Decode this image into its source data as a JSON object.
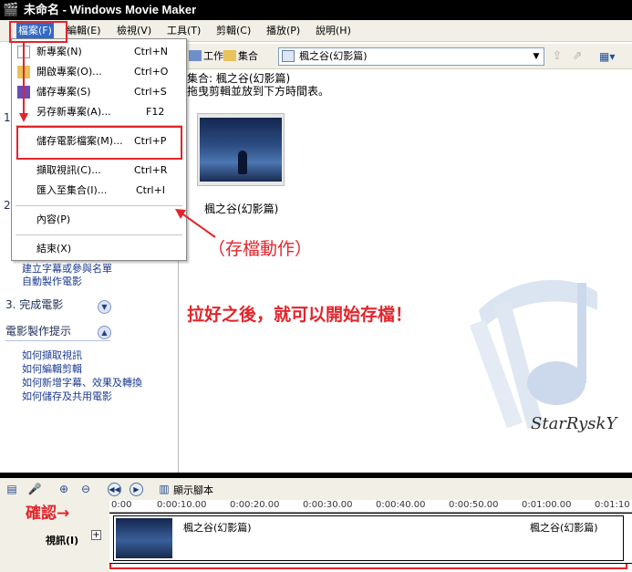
{
  "window": {
    "title": "未命名 - Windows Movie Maker"
  },
  "menu": {
    "items": [
      "檔案(F)",
      "編輯(E)",
      "檢視(V)",
      "工具(T)",
      "剪輯(C)",
      "播放(P)",
      "說明(H)"
    ]
  },
  "file_menu": {
    "items": [
      {
        "label": "新專案(N)",
        "shortcut": "Ctrl+N"
      },
      {
        "label": "開啟專案(O)...",
        "shortcut": "Ctrl+O"
      },
      {
        "label": "儲存專案(S)",
        "shortcut": "Ctrl+S"
      },
      {
        "label": "另存新專案(A)...",
        "shortcut": "F12"
      },
      {
        "label": "儲存電影檔案(M)...",
        "shortcut": "Ctrl+P"
      },
      {
        "label": "擷取視訊(C)...",
        "shortcut": "Ctrl+R"
      },
      {
        "label": "匯入至集合(I)...",
        "shortcut": "Ctrl+I"
      },
      {
        "label": "內容(P)",
        "shortcut": ""
      },
      {
        "label": "結束(X)",
        "shortcut": ""
      }
    ]
  },
  "toolbar": {
    "tasks_label": "工作",
    "collections_label": "集合",
    "collection_selected": "楓之谷(幻影篇)"
  },
  "content": {
    "header_line1": "集合: 楓之谷(幻影篇)",
    "header_line2": "拖曳剪輯並放到下方時間表。",
    "clip_label": "楓之谷(幻影篇)"
  },
  "task_pane": {
    "section1_num": "1",
    "section2_num": "2",
    "links_2": [
      "建立字幕或參與名單",
      "自動製作電影"
    ],
    "section3": "3. 完成電影",
    "tips_heading": "電影製作提示",
    "tips": [
      "如何擷取視訊",
      "如何編輯剪輯",
      "如何新增字幕、效果及轉換",
      "如何儲存及共用電影"
    ]
  },
  "annotations": {
    "save_action": "（存檔動作）",
    "start_saving": "拉好之後，就可以開始存檔！",
    "confirm": "確認→",
    "watermark": "StarRyskY"
  },
  "timeline": {
    "show_script": "顯示腳本",
    "ruler_ticks": [
      "0:00",
      "0:00:10.00",
      "0:00:20.00",
      "0:00:30.00",
      "0:00:40.00",
      "0:00:50.00",
      "0:01:00.00",
      "0:01:10"
    ],
    "track_name": "視訊(I)",
    "clip_title_start": "楓之谷(幻影篇)",
    "clip_title_end": "楓之谷(幻影篇)"
  },
  "colors": {
    "highlight_red": "#e3242b",
    "menu_highlight": "#316ac5",
    "title_bar": "#000000"
  }
}
